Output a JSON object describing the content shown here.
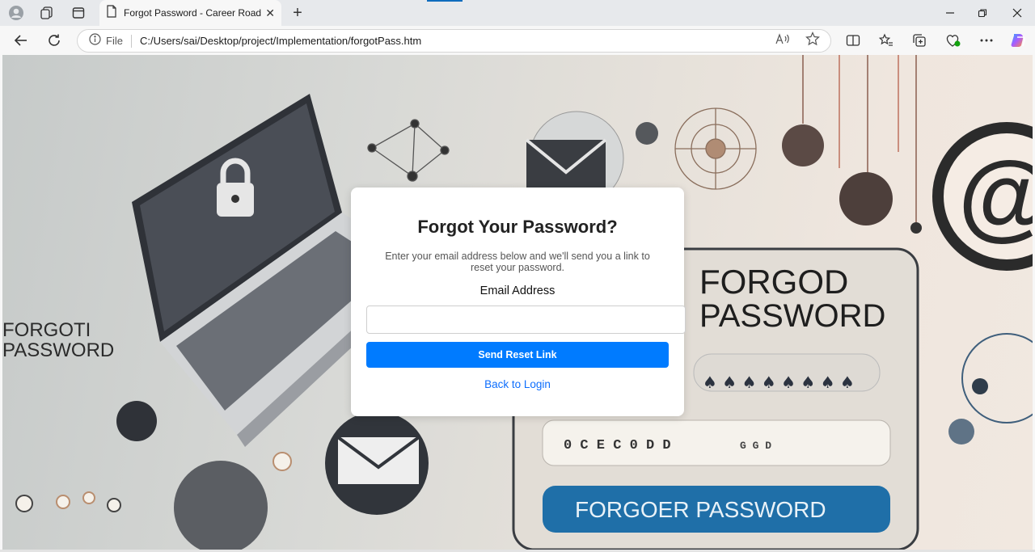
{
  "browser": {
    "tab_title": "Forgot Password - Career Roadmap",
    "address_prefix": "File",
    "url": "C:/Users/sai/Desktop/project/Implementation/forgotPass.htm"
  },
  "background_art": {
    "left_text_line1": "FORGOTI",
    "left_text_line2": "PASSWORD",
    "right_text_line1": "FORGOD",
    "right_text_line2": "PASSWORD",
    "field_text": "0 C E C 0 D D",
    "field_text_tail": "G G D",
    "button_text": "FORGOER   PASSWORD",
    "at_symbol": "@",
    "masked": "♠ ♠ ♠ ♠ ♠ ♠ ♠ ♠"
  },
  "form": {
    "title": "Forgot Your Password?",
    "description": "Enter your email address below and we'll send you a link to reset your password.",
    "email_label": "Email Address",
    "email_value": "",
    "email_placeholder": "",
    "submit_label": "Send Reset Link",
    "back_link": "Back to Login"
  },
  "colors": {
    "primary": "#007bff",
    "link": "#0d6efd"
  }
}
